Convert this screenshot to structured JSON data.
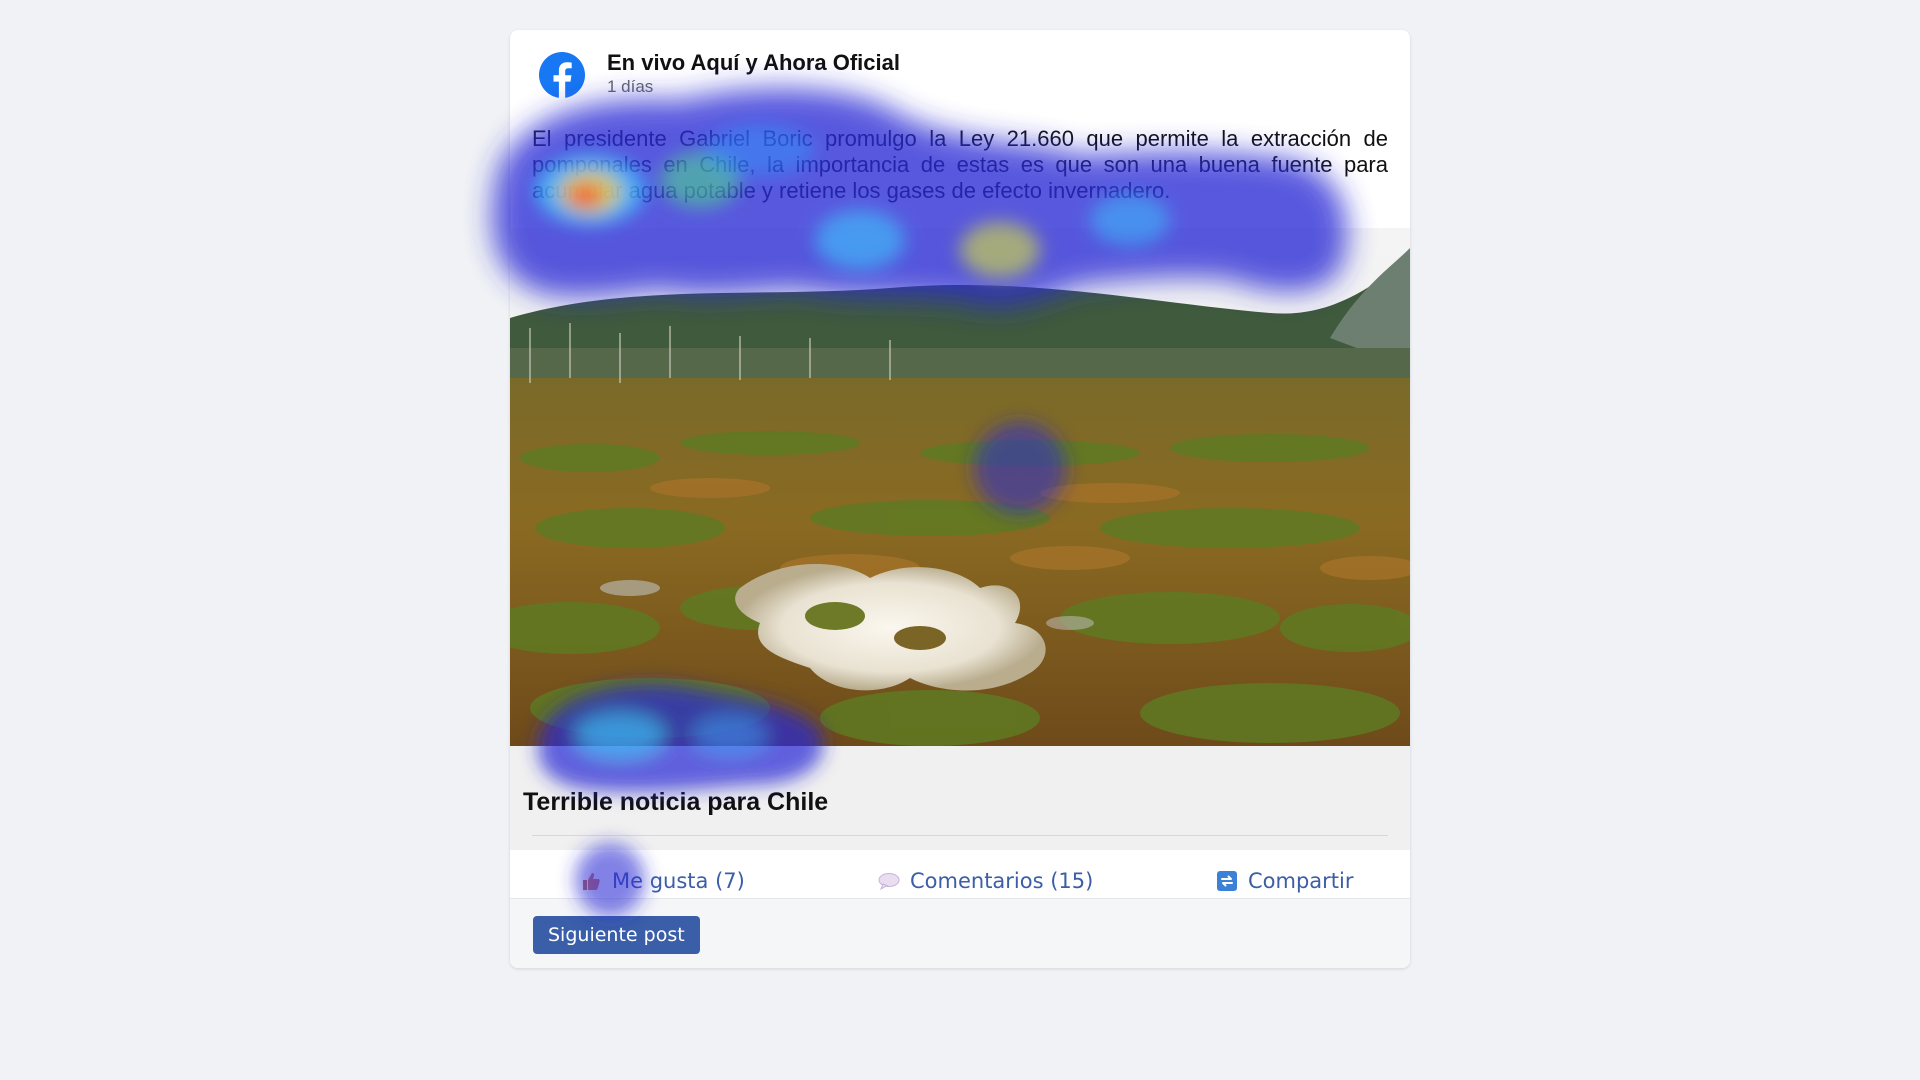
{
  "post": {
    "page_name": "En vivo Aquí y Ahora Oficial",
    "time": "1 días",
    "text": "El presidente Gabriel Boric promulgo la Ley 21.660 que permite la extracción de pomponales en Chile, la importancia de estas es que son una buena fuente para acumular agua potable y retiene los gases de efecto invernadero.",
    "link_title": "Terrible noticia para Chile"
  },
  "actions": {
    "like": "Me gusta (7)",
    "comment": "Comentarios (15)",
    "share": "Compartir"
  },
  "footer": {
    "next_button": "Siguiente post"
  },
  "colors": {
    "facebook_blue": "#1877f2",
    "action_blue": "#3b5ea6",
    "button_blue": "#3a5ea8"
  },
  "icons": {
    "logo": "facebook-logo-icon",
    "like": "thumbs-up-icon",
    "comment": "speech-bubble-icon",
    "share": "share-icon"
  }
}
